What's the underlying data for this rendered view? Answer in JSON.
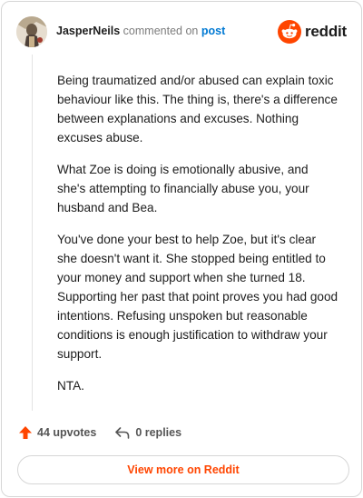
{
  "comment": {
    "author": "JasperNeils",
    "verb": "commented on",
    "post_link": "post",
    "paragraphs": [
      "Being traumatized and/or abused can explain toxic behaviour like this. The thing is, there's a difference between explanations and excuses. Nothing excuses abuse.",
      "What Zoe is doing is emotionally abusive, and she's attempting to financially abuse you, your husband and Bea.",
      "You've done your best to help Zoe, but it's clear she doesn't want it. She stopped being entitled to your money and support when she turned 18. Supporting her past that point proves you had good intentions. Refusing unspoken but reasonable conditions is enough justification to withdraw your support.",
      "NTA."
    ]
  },
  "brand": {
    "wordmark": "reddit",
    "logo_icon": "reddit-snoo-icon",
    "accent_color": "#ff4500"
  },
  "actions": {
    "upvotes_label": "44 upvotes",
    "replies_label": "0 replies",
    "upvote_icon": "upvote-arrow-icon",
    "reply_icon": "reply-arrow-icon",
    "upvote_color": "#ff4500"
  },
  "footer": {
    "view_more_label": "View more on Reddit"
  },
  "colors": {
    "link": "#0079d3",
    "muted": "#7c7c7c",
    "border": "#d6d6d6"
  }
}
